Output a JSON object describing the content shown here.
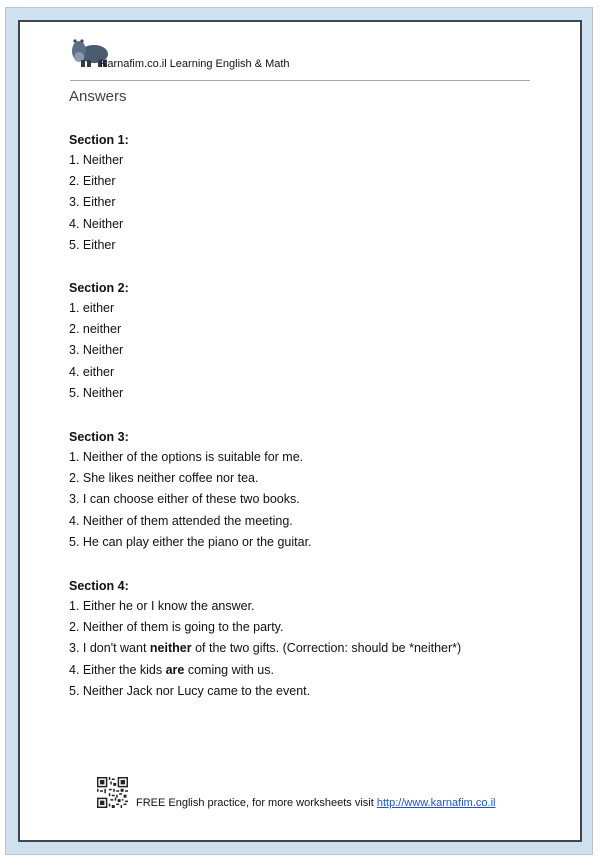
{
  "header": {
    "logo_icon": "hippo-icon",
    "site_title": "Karnafim.co.il Learning English & Math",
    "page_title": "Answers"
  },
  "sections": [
    {
      "title": "Section 1:",
      "items": [
        {
          "text": "1. Neither"
        },
        {
          "text": "2. Either"
        },
        {
          "text": "3. Either"
        },
        {
          "text": "4. Neither"
        },
        {
          "text": "5. Either"
        }
      ]
    },
    {
      "title": "Section 2:",
      "items": [
        {
          "text": "1. either"
        },
        {
          "text": "2. neither"
        },
        {
          "text": "3. Neither"
        },
        {
          "text": "4. either"
        },
        {
          "text": "5. Neither"
        }
      ]
    },
    {
      "title": "Section 3:",
      "items": [
        {
          "text": "1. Neither of the options is suitable for me."
        },
        {
          "text": "2. She likes neither coffee nor tea."
        },
        {
          "text": "3. I can choose either of these two books."
        },
        {
          "text": "4. Neither of them attended the meeting."
        },
        {
          "text": "5. He can play either the piano or the guitar."
        }
      ]
    },
    {
      "title": "Section 4:",
      "items": [
        {
          "text": "1. Either he or I know the answer."
        },
        {
          "text": "2. Neither of them is going to the party."
        },
        {
          "pre": "3. I don't want ",
          "bold": "neither",
          "post": " of the two gifts. (Correction: should be *neither*)"
        },
        {
          "pre": "4. Either the kids ",
          "bold": "are",
          "post": " coming with us."
        },
        {
          "text": "5. Neither Jack nor Lucy came to the event."
        }
      ]
    }
  ],
  "footer": {
    "qr_icon": "qr-code-icon",
    "text": "FREE English practice, for more worksheets visit ",
    "link_text": "http://www.karnafim.co.il"
  },
  "colors": {
    "frame": "#cfe0f0",
    "page_border": "#3e4650",
    "link": "#1a55c8"
  }
}
